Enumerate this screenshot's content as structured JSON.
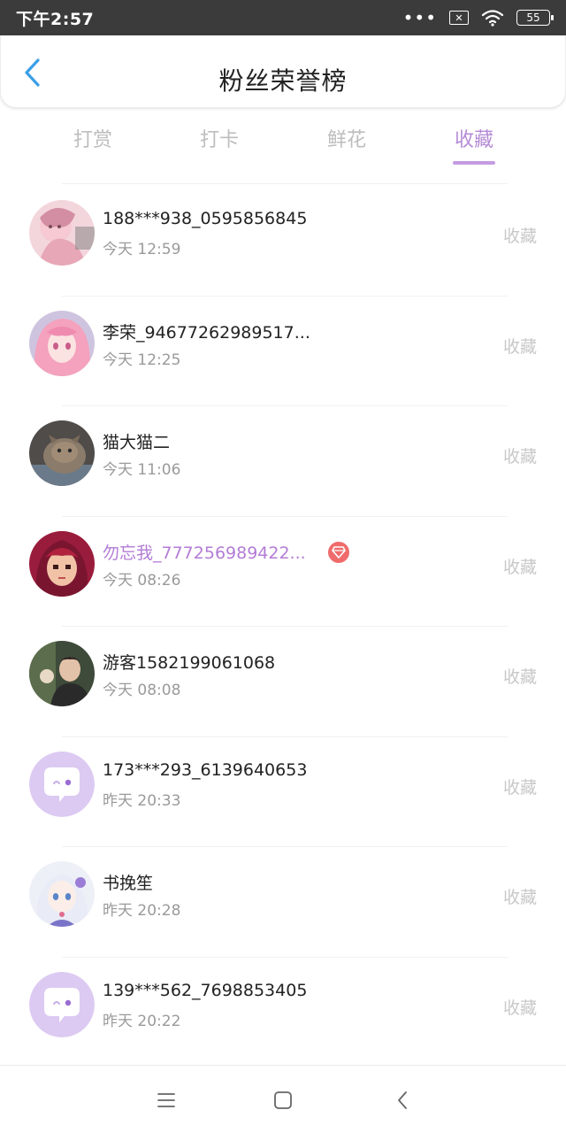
{
  "status_bar": {
    "time": "下午2:57",
    "dots": "•••",
    "sim": "✕",
    "battery": "55"
  },
  "header": {
    "title": "粉丝荣誉榜"
  },
  "tabs": [
    {
      "label": "打赏",
      "active": false
    },
    {
      "label": "打卡",
      "active": false
    },
    {
      "label": "鲜花",
      "active": false
    },
    {
      "label": "收藏",
      "active": true
    }
  ],
  "list": [
    {
      "name": "188***938_0595856845",
      "time": "今天 12:59",
      "action": "收藏",
      "vip": false,
      "avatar": "pink-girl"
    },
    {
      "name": "李荣_94677262989517...",
      "time": "今天 12:25",
      "action": "收藏",
      "vip": false,
      "avatar": "pink-hair"
    },
    {
      "name": "猫大猫二",
      "time": "今天 11:06",
      "action": "收藏",
      "vip": false,
      "avatar": "cat"
    },
    {
      "name": "勿忘我_777256989422...",
      "time": "今天 08:26",
      "action": "收藏",
      "vip": true,
      "avatar": "pixel-girl"
    },
    {
      "name": "游客1582199061068",
      "time": "今天 08:08",
      "action": "收藏",
      "vip": false,
      "avatar": "photo-man"
    },
    {
      "name": "173***293_6139640653",
      "time": "昨天 20:33",
      "action": "收藏",
      "vip": false,
      "avatar": "default-bubble"
    },
    {
      "name": "书挽笙",
      "time": "昨天 20:28",
      "action": "收藏",
      "vip": false,
      "avatar": "anime-white"
    },
    {
      "name": "139***562_7698853405",
      "time": "昨天 20:22",
      "action": "收藏",
      "vip": false,
      "avatar": "default-bubble"
    }
  ],
  "colors": {
    "accent": "#b58bd6",
    "vip_name": "#b37cd6",
    "back_arrow": "#3a9ee8",
    "vip_badge": "#f06b6b"
  }
}
